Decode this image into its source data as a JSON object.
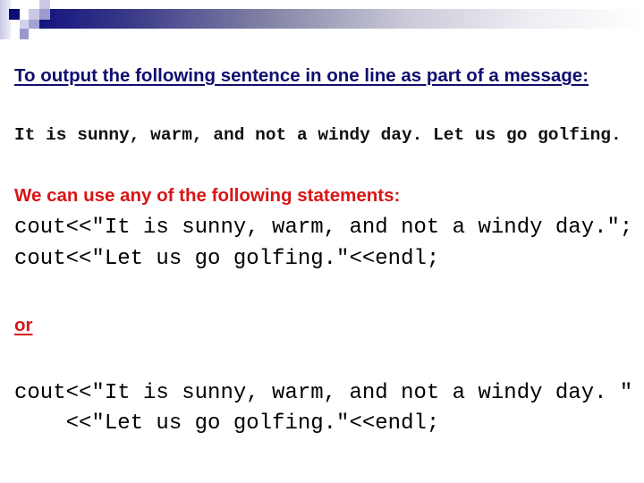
{
  "slide": {
    "heading": "To output the following sentence in one line as part of a message:",
    "sentence": "It is sunny, warm, and not a windy day. Let us go golfing.",
    "statements_heading": "We can use any of the following statements:",
    "option1_lines": [
      "cout<<\"It is sunny, warm, and not a windy day.\";",
      "cout<<\"Let us go golfing.\"<<endl;"
    ],
    "separator": "or",
    "option2_lines": [
      "cout<<\"It is sunny, warm, and not a windy day. \"",
      "    <<\"Let us go golfing.\"<<endl;"
    ]
  },
  "theme": {
    "heading_color": "#0f0f6e",
    "accent_red": "#d81515",
    "bar_dark": "#141480"
  }
}
